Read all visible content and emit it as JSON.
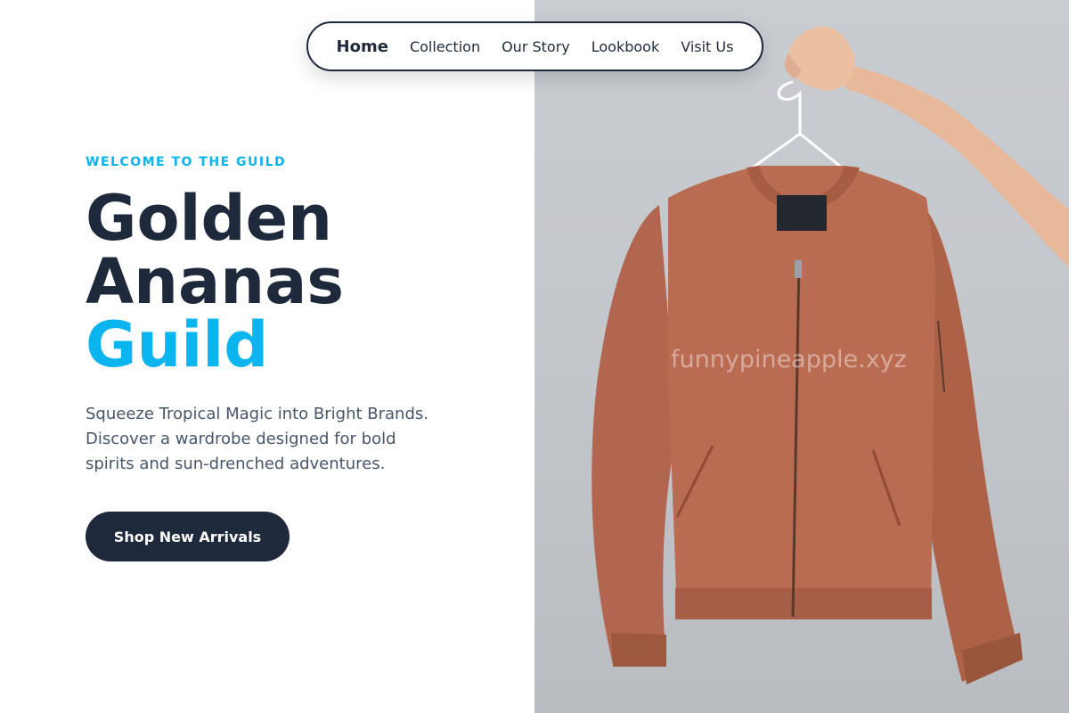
{
  "nav": {
    "items": [
      {
        "label": "Home",
        "active": true
      },
      {
        "label": "Collection",
        "active": false
      },
      {
        "label": "Our Story",
        "active": false
      },
      {
        "label": "Lookbook",
        "active": false
      },
      {
        "label": "Visit Us",
        "active": false
      }
    ]
  },
  "hero": {
    "eyebrow": "WELCOME TO THE GUILD",
    "title_line1": "Golden",
    "title_line2": "Ananas",
    "title_accent": "Guild",
    "description": "Squeeze Tropical Magic into Bright Brands. Discover a wardrobe designed for bold spirits and sun-drenched adventures.",
    "cta_label": "Shop New Arrivals"
  },
  "image": {
    "watermark": "funnypineapple.xyz",
    "subject": "rust-colored bomber jacket on a hanger held by a hand"
  },
  "colors": {
    "accent": "#0ab4ee",
    "dark": "#1e293b",
    "body_text": "#475569",
    "jacket": "#b86b50",
    "backdrop": "#c6c9ce"
  }
}
